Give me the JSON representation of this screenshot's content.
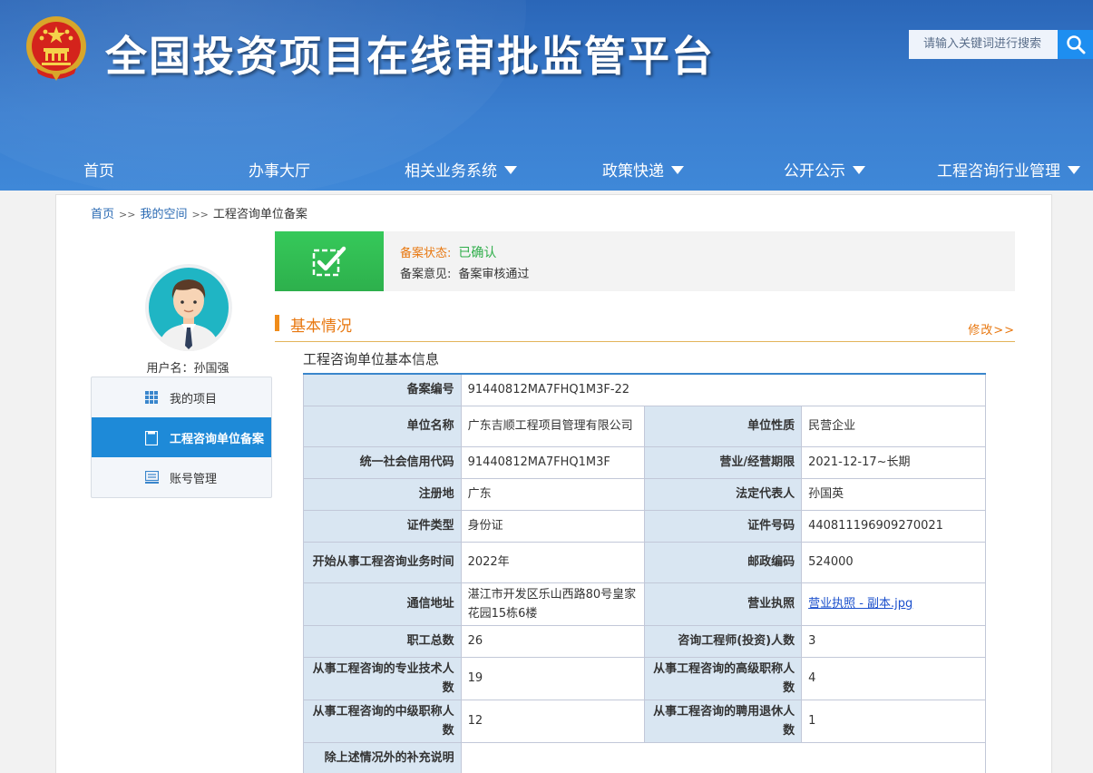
{
  "header": {
    "title": "全国投资项目在线审批监管平台",
    "search_placeholder": "请输入关键词进行搜索"
  },
  "nav": [
    {
      "label": "首页",
      "dropdown": false
    },
    {
      "label": "办事大厅",
      "dropdown": false
    },
    {
      "label": "相关业务系统",
      "dropdown": true
    },
    {
      "label": "政策快递",
      "dropdown": true
    },
    {
      "label": "公开公示",
      "dropdown": true
    },
    {
      "label": "工程咨询行业管理",
      "dropdown": true
    }
  ],
  "breadcrumb": {
    "home": "首页",
    "sep": ">>",
    "space": "我的空间",
    "current": "工程咨询单位备案"
  },
  "user": {
    "username_label": "用户名：孙国强"
  },
  "side_menu": [
    {
      "label": "我的项目",
      "icon": "grid-icon",
      "active": false
    },
    {
      "label": "工程咨询单位备案",
      "icon": "document-icon",
      "active": true
    },
    {
      "label": "账号管理",
      "icon": "account-icon",
      "active": false
    }
  ],
  "status": {
    "state_label": "备案状态:",
    "state_value": "已确认",
    "opinion_label": "备案意见:",
    "opinion_value": "备案审核通过"
  },
  "section": {
    "title": "基本情况",
    "modify": "修改>>"
  },
  "table_title": "工程咨询单位基本信息",
  "table": {
    "record_no_label": "备案编号",
    "record_no": "91440812MA7FHQ1M3F-22",
    "unit_name_label": "单位名称",
    "unit_name": "广东吉顺工程项目管理有限公司",
    "unit_nature_label": "单位性质",
    "unit_nature": "民营企业",
    "credit_code_label": "统一社会信用代码",
    "credit_code": "91440812MA7FHQ1M3F",
    "term_label": "营业/经营期限",
    "term": "2021-12-17~长期",
    "reg_place_label": "注册地",
    "reg_place": "广东",
    "legal_rep_label": "法定代表人",
    "legal_rep": "孙国英",
    "id_type_label": "证件类型",
    "id_type": "身份证",
    "id_no_label": "证件号码",
    "id_no": "440811196909270021",
    "start_year_label": "开始从事工程咨询业务时间",
    "start_year": "2022年",
    "postcode_label": "邮政编码",
    "postcode": "524000",
    "address_label": "通信地址",
    "address": "湛江市开发区乐山西路80号皇家花园15栋6楼",
    "license_label": "营业执照",
    "license_file": "营业执照 - 副本.jpg",
    "staff_total_label": "职工总数",
    "staff_total": "26",
    "engineers_label": "咨询工程师(投资)人数",
    "engineers": "3",
    "tech_staff_label": "从事工程咨询的专业技术人数",
    "tech_staff": "19",
    "senior_title_label": "从事工程咨询的高级职称人数",
    "senior_title": "4",
    "mid_title_label": "从事工程咨询的中级职称人数",
    "mid_title": "12",
    "retired_label": "从事工程咨询的聘用退休人数",
    "retired": "1",
    "supplement_label": "除上述情况外的补充说明",
    "supplement": ""
  },
  "colors": {
    "header_blue": "#2a66b8",
    "accent_orange": "#e8770f",
    "success_green": "#2fae4a",
    "active_menu": "#1e8ad8"
  }
}
